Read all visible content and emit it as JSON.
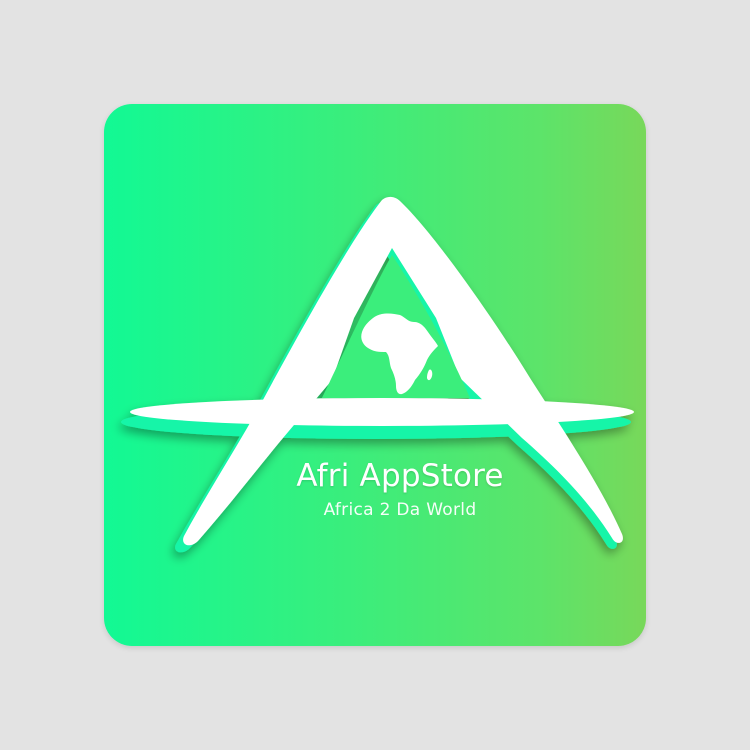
{
  "logo": {
    "name": "Afri AppStore",
    "tagline": "Africa 2 Da World",
    "glyph": "letter-a-with-orbit-ring",
    "inner_icon": "africa-continent-icon"
  },
  "colors": {
    "background": "#e3e3e3",
    "gradient_start": "#12f994",
    "gradient_end": "#78d85a",
    "logo_fill": "#ffffff",
    "logo_outline": "#18f5a8"
  }
}
